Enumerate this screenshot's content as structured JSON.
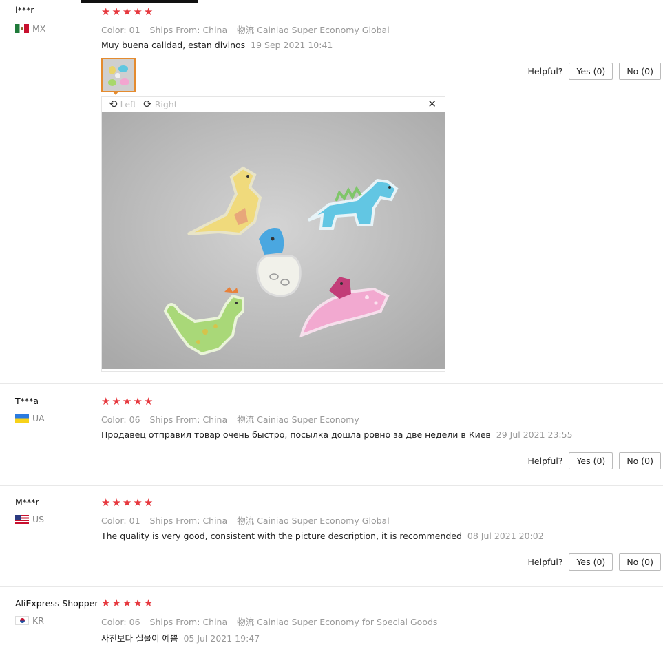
{
  "reviews": [
    {
      "user": "l***r",
      "country": "MX",
      "flag": "mx",
      "stars": 5,
      "color_label": "Color:",
      "color_value": "01",
      "ships_label": "Ships From:",
      "ships_value": "China",
      "logistics_label": "物流",
      "logistics_value": "Cainiao Super Economy Global",
      "text": "Muy buena calidad, estan divinos",
      "date": "19 Sep 2021 10:41",
      "helpful_label": "Helpful?",
      "yes_label": "Yes (0)",
      "no_label": "No (0)"
    },
    {
      "user": "T***a",
      "country": "UA",
      "flag": "ua",
      "stars": 5,
      "color_label": "Color:",
      "color_value": "06",
      "ships_label": "Ships From:",
      "ships_value": "China",
      "logistics_label": "物流",
      "logistics_value": "Cainiao Super Economy",
      "text": "Продавец отправил товар очень быстро, посылка дошла ровно за две недели в Киев",
      "date": "29 Jul 2021 23:55",
      "helpful_label": "Helpful?",
      "yes_label": "Yes (0)",
      "no_label": "No (0)"
    },
    {
      "user": "M***r",
      "country": "US",
      "flag": "us",
      "stars": 5,
      "color_label": "Color:",
      "color_value": "01",
      "ships_label": "Ships From:",
      "ships_value": "China",
      "logistics_label": "物流",
      "logistics_value": "Cainiao Super Economy Global",
      "text": "The quality is very good, consistent with the picture description, it is recommended",
      "date": "08 Jul 2021 20:02",
      "helpful_label": "Helpful?",
      "yes_label": "Yes (0)",
      "no_label": "No (0)"
    },
    {
      "user": "AliExpress Shopper",
      "country": "KR",
      "flag": "kr",
      "stars": 5,
      "color_label": "Color:",
      "color_value": "06",
      "ships_label": "Ships From:",
      "ships_value": "China",
      "logistics_label": "物流",
      "logistics_value": "Cainiao Super Economy for Special Goods",
      "text": "사진보다 실물이 예쁨",
      "date": "05 Jul 2021 19:47"
    }
  ],
  "viewer": {
    "rotate_left_label": "Left",
    "rotate_right_label": "Right",
    "rotate_left_icon": "rotate-left-icon",
    "rotate_right_icon": "rotate-right-icon",
    "close_icon": "close-icon"
  },
  "colors": {
    "star": "#e6393f",
    "thumb_border": "#e48b2f"
  }
}
